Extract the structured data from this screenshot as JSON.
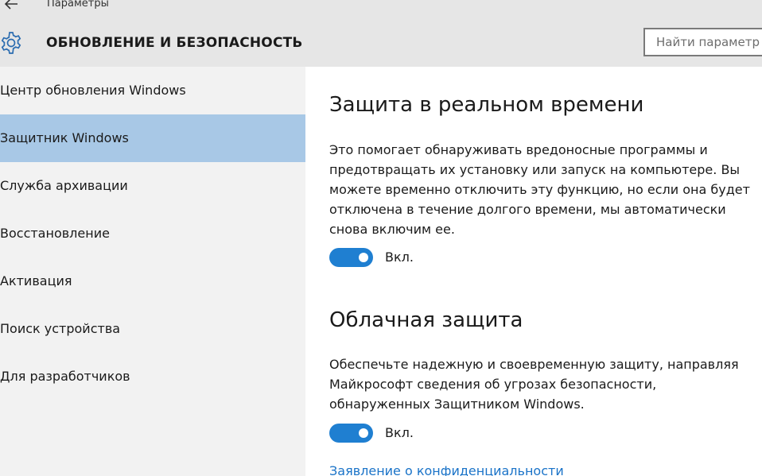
{
  "window": {
    "title": "Параметры"
  },
  "header": {
    "back_icon": "arrow-left-icon",
    "gear_icon": "gear-icon",
    "section_title": "ОБНОВЛЕНИЕ И БЕЗОПАСНОСТЬ",
    "search_placeholder": "Найти параметр"
  },
  "sidebar": {
    "items": [
      {
        "label": "Центр обновления Windows",
        "selected": false
      },
      {
        "label": "Защитник Windows",
        "selected": true
      },
      {
        "label": "Служба архивации",
        "selected": false
      },
      {
        "label": "Восстановление",
        "selected": false
      },
      {
        "label": "Активация",
        "selected": false
      },
      {
        "label": "Поиск устройства",
        "selected": false
      },
      {
        "label": "Для разработчиков",
        "selected": false
      }
    ]
  },
  "main": {
    "realtime": {
      "title": "Защита в реальном времени",
      "description": "Это помогает обнаруживать вредоносные программы и предотвращать их установку или запуск на компьютере. Вы можете временно отключить эту функцию, но если она будет отключена в течение долгого времени, мы автоматически снова включим ее.",
      "toggle_state": "on",
      "toggle_label": "Вкл."
    },
    "cloud": {
      "title": "Облачная защита",
      "description": "Обеспечьте надежную и своевременную защиту, направляя Майкрософт сведения об угрозах безопасности, обнаруженных Защитником Windows.",
      "toggle_state": "on",
      "toggle_label": "Вкл."
    },
    "privacy_link": "Заявление о конфиденциальности"
  },
  "colors": {
    "header_bg": "#e6e6e6",
    "sidebar_bg": "#f2f2f2",
    "selected_bg": "#a8c8e6",
    "accent": "#1f7fd1",
    "link": "#1a73c8"
  }
}
